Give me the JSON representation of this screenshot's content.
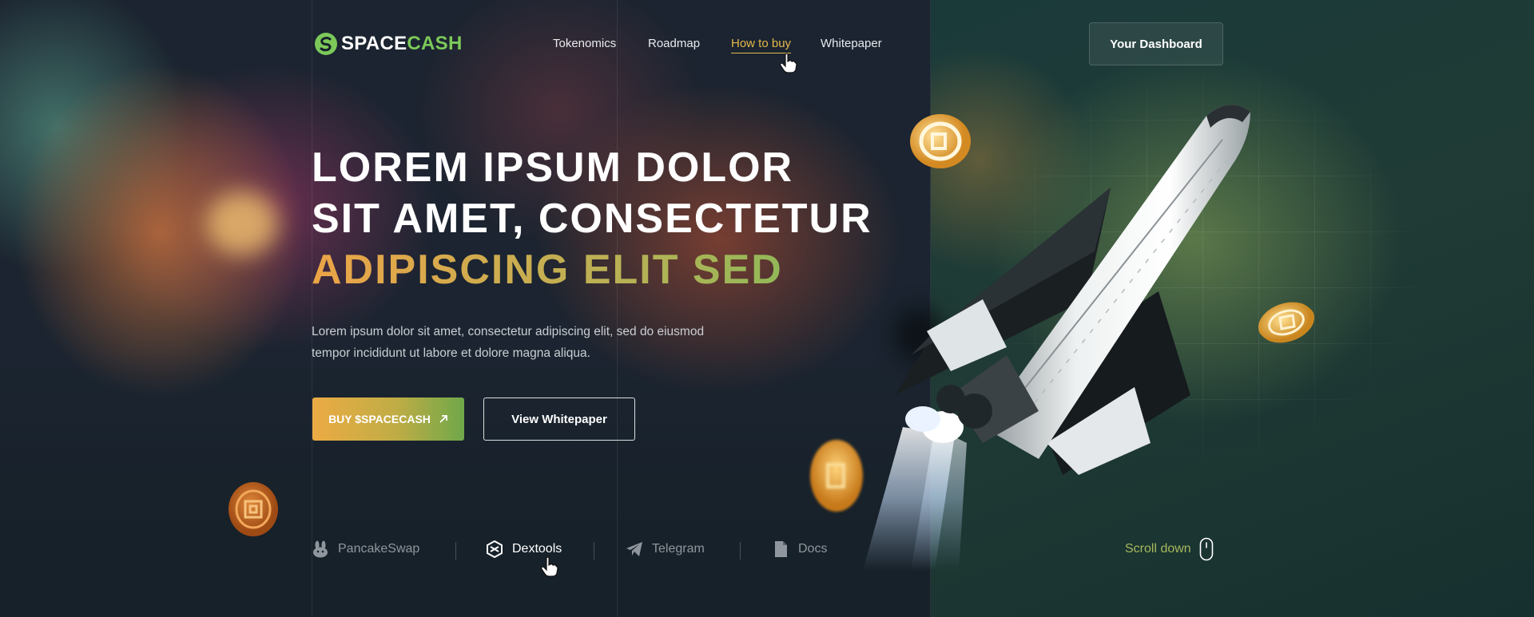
{
  "brand": {
    "name_part1": "SPACE",
    "name_part2": "CASH",
    "accent": "#7cc95a"
  },
  "nav": {
    "items": [
      {
        "label": "Tokenomics",
        "active": false
      },
      {
        "label": "Roadmap",
        "active": false
      },
      {
        "label": "How to buy",
        "active": true
      },
      {
        "label": "Whitepaper",
        "active": false
      }
    ],
    "dashboard_label": "Your Dashboard"
  },
  "hero": {
    "line1": "LOREM IPSUM DOLOR",
    "line2": "SIT AMET, CONSECTETUR",
    "line3": "ADIPISCING ELIT SED",
    "subtitle_line1": "Lorem ipsum dolor sit amet, consectetur adipiscing elit, sed do eiusmod",
    "subtitle_line2": "tempor incididunt ut labore et dolore magna aliqua.",
    "buy_label": "BUY $SPACECASH",
    "whitepaper_label": "View Whitepaper"
  },
  "links": [
    {
      "label": "PancakeSwap",
      "icon": "rabbit-icon",
      "active": false
    },
    {
      "label": "Dextools",
      "icon": "dextools-icon",
      "active": true
    },
    {
      "label": "Telegram",
      "icon": "paper-plane-icon",
      "active": false
    },
    {
      "label": "Docs",
      "icon": "document-icon",
      "active": false
    }
  ],
  "scroll_label": "Scroll down",
  "colors": {
    "gold": "#e5b84c",
    "green": "#7cbd5a",
    "background": "#172129"
  }
}
